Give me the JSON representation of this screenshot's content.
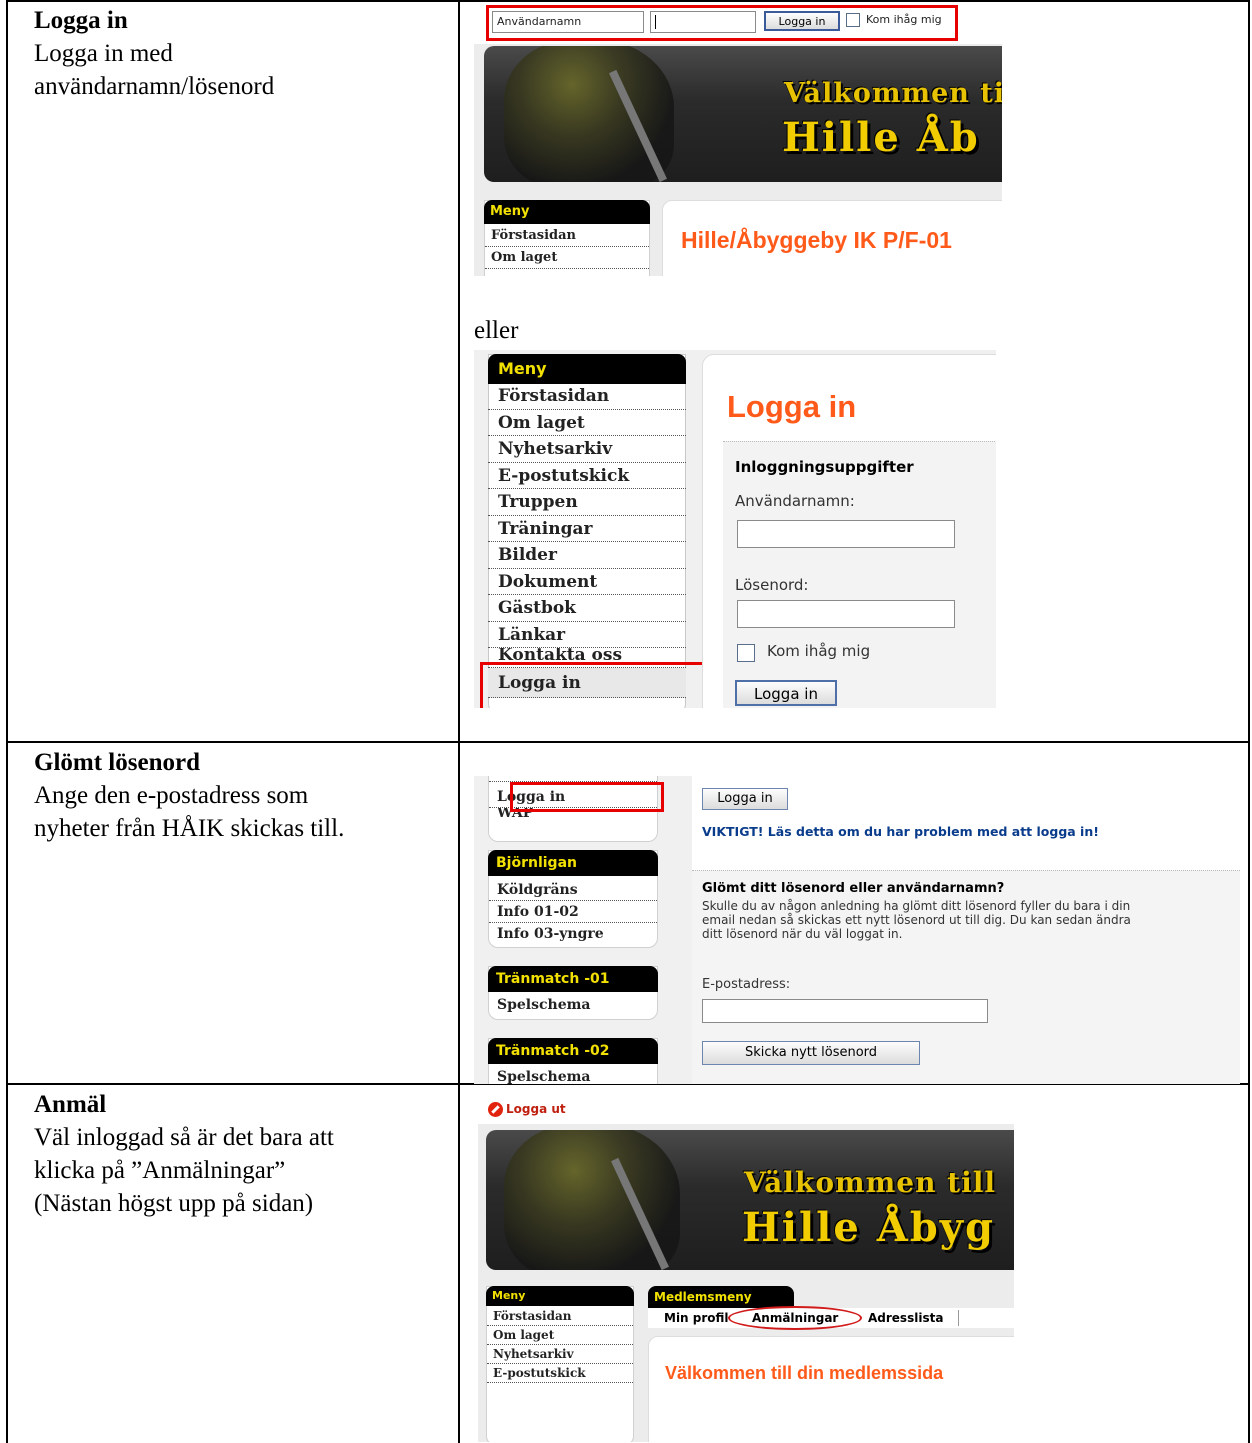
{
  "rows": [
    {
      "heading": "Logga in",
      "lines": [
        "Logga in med",
        "användarnamn/lösenord"
      ]
    },
    {
      "heading": "Glömt lösenord",
      "lines": [
        "Ange den e-postadress som",
        "nyheter från HÅIK skickas till."
      ]
    },
    {
      "heading": "Anmäl",
      "lines": [
        "Väl inloggad så är det bara att",
        "klicka på ”Anmälningar”",
        "(Nästan högst upp på sidan)"
      ]
    }
  ],
  "shot1": {
    "username_placeholder": "Användarnamn",
    "login_button": "Logga in",
    "remember_me": "Kom ihåg mig",
    "banner_line1": "Välkommen ti",
    "banner_line2": "Hille Åb",
    "menu_title": "Meny",
    "menu_items": [
      "Förstasidan",
      "Om laget"
    ],
    "page_heading": "Hille/Åbyggeby IK P/F-01"
  },
  "separator_word": "eller",
  "shot2": {
    "menu_title": "Meny",
    "menu_items": [
      "Förstasidan",
      "Om laget",
      "Nyhetsarkiv",
      "E-postutskick",
      "Truppen",
      "Träningar",
      "Bilder",
      "Dokument",
      "Gästbok",
      "Länkar",
      "Kontakta oss",
      "Logga in"
    ],
    "page_heading": "Logga in",
    "form_title": "Inloggningsuppgifter",
    "username_label": "Användarnamn:",
    "password_label": "Lösenord:",
    "remember_me": "Kom ihåg mig",
    "login_button": "Logga in"
  },
  "shot3": {
    "menu_items_top": [
      "Logga in",
      "WAP"
    ],
    "group1_title": "Björnligan",
    "group1_items": [
      "Köldgräns",
      "Info 01-02",
      "Info 03-yngre"
    ],
    "group2_title": "Tränmatch -01",
    "group2_items": [
      "Spelschema"
    ],
    "group3_title": "Tränmatch -02",
    "group3_items": [
      "Spelschema"
    ],
    "login_button": "Logga in",
    "important_link": "VIKTIGT! Läs detta om du har problem med att logga in!",
    "forgot_title": "Glömt ditt lösenord eller användarnamn?",
    "forgot_text": [
      "Skulle du av någon anledning ha glömt ditt lösenord fyller du bara i din",
      "email nedan så skickas ett nytt lösenord ut till dig. Du kan sedan ändra",
      "ditt lösenord när du väl loggat in."
    ],
    "email_label": "E-postadress:",
    "send_button": "Skicka nytt lösenord"
  },
  "shot4": {
    "logout": "Logga ut",
    "banner_line1": "Välkommen till",
    "banner_line2": "Hille Åbyg",
    "menu_title": "Meny",
    "menu_items": [
      "Förstasidan",
      "Om laget",
      "Nyhetsarkiv",
      "E-postutskick"
    ],
    "member_menu_title": "Medlemsmeny",
    "tabs": [
      "Min profil",
      "Anmälningar",
      "Adresslista"
    ],
    "welcome": "Välkommen till din medlemssida"
  },
  "colors": {
    "accent_orange": "#ff5a1a",
    "menu_header_bg": "#000000",
    "menu_header_text": "#f2e100",
    "highlight_red": "#e60000",
    "link_blue": "#0a3c8c"
  }
}
